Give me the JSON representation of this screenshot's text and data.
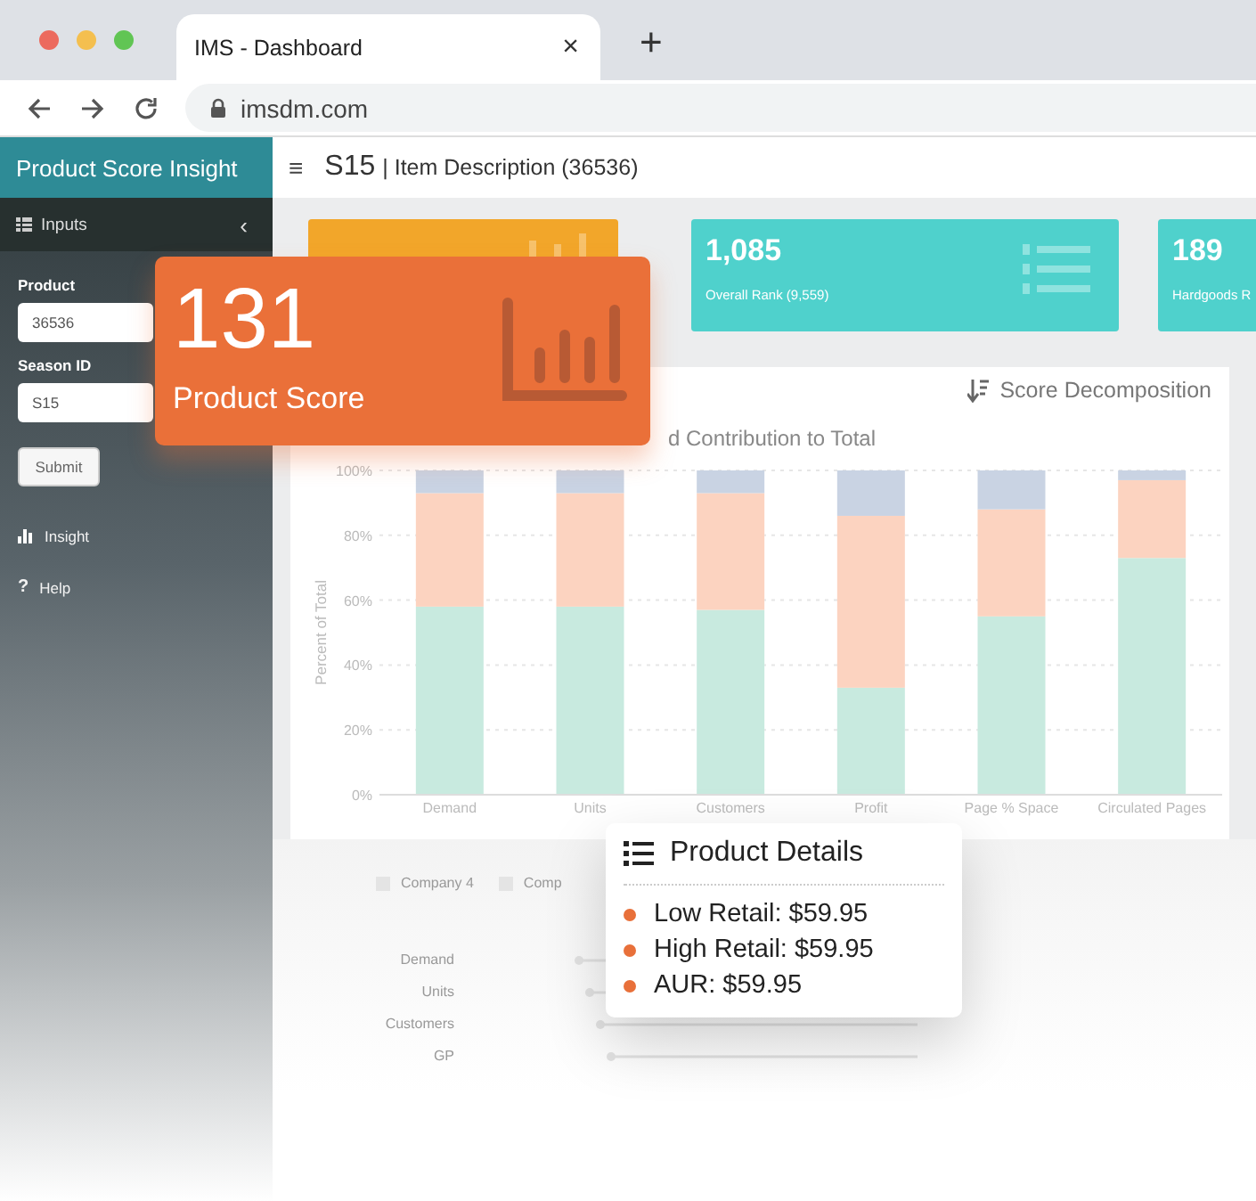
{
  "browser": {
    "tab_title": "IMS - Dashboard",
    "tab_close": "×",
    "new_tab": "+",
    "url": "imsdm.com"
  },
  "sidebar": {
    "title": "Product Score Insight",
    "section": "Inputs",
    "collapse": "‹",
    "fields": [
      {
        "label": "Product",
        "value": "36536"
      },
      {
        "label": "Season ID",
        "value": "S15"
      }
    ],
    "submit": "Submit",
    "items": [
      {
        "kind": "insight",
        "label": "Insight"
      },
      {
        "kind": "help",
        "icon": "?",
        "label": "Help"
      }
    ]
  },
  "header": {
    "menu": "≡",
    "season": "S15",
    "description": "| Item Description (36536)"
  },
  "cards": [
    {
      "kind": "score",
      "color": "#f2a62a"
    },
    {
      "kind": "rank",
      "value": "1,085",
      "label": "Overall Rank (9,559)",
      "color": "#4fd1cc"
    },
    {
      "kind": "plain",
      "value": "189",
      "label": "Hardgoods R",
      "color": "#4fd1cc"
    }
  ],
  "score_popup": {
    "value": "131",
    "label": "Product Score"
  },
  "chart_panel": {
    "heading": "Score Decomposition",
    "chart_data": {
      "type": "bar",
      "stacked": true,
      "grid": true,
      "title": "d Contribution to Total",
      "ylabel": "Percent of Total",
      "categories": [
        "Demand",
        "Units",
        "Customers",
        "Profit",
        "Page % Space",
        "Circulated Pages"
      ],
      "series": [
        {
          "color": "#c8eadf",
          "values": [
            58,
            58,
            57,
            33,
            55,
            73
          ]
        },
        {
          "color": "#fcd3c0",
          "values": [
            35,
            35,
            36,
            53,
            33,
            24
          ]
        },
        {
          "color": "#c9d3e3",
          "values": [
            7,
            7,
            7,
            14,
            12,
            3
          ]
        }
      ],
      "ylim": [
        0,
        100
      ],
      "yticks": [
        {
          "value": 0,
          "label": "0%"
        },
        {
          "value": 20,
          "label": "20%"
        },
        {
          "value": 40,
          "label": "40%"
        },
        {
          "value": 60,
          "label": "60%"
        },
        {
          "value": 80,
          "label": "80%"
        },
        {
          "value": 100,
          "label": "100%"
        }
      ]
    }
  },
  "lower_panel": {
    "legend": [
      "Company 4",
      "Comp"
    ],
    "rows": [
      "Demand",
      "Units",
      "Customers",
      "GP"
    ]
  },
  "details_popup": {
    "title": "Product Details",
    "items": [
      "Low Retail: $59.95",
      "High Retail: $59.95",
      "AUR: $59.95"
    ]
  }
}
